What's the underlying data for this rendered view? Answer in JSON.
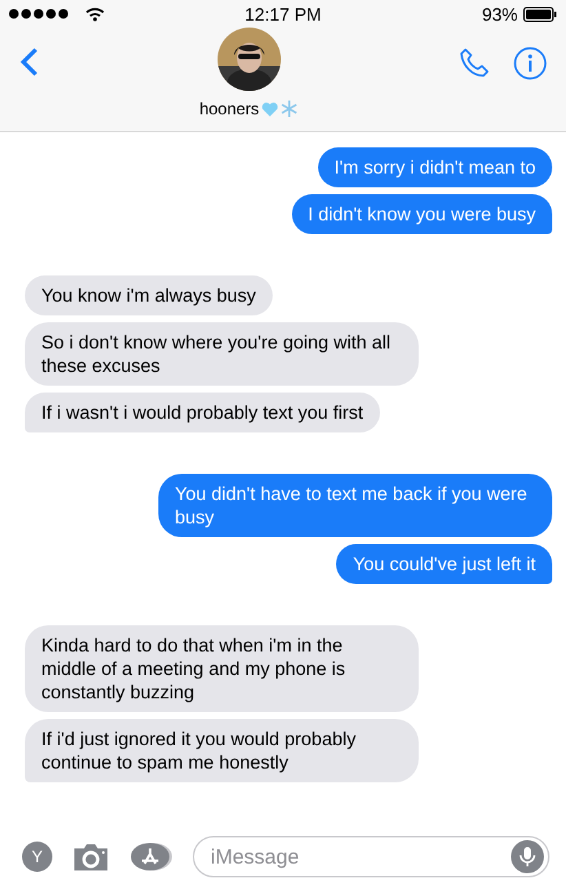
{
  "status_bar": {
    "time": "12:17 PM",
    "battery": "93%"
  },
  "contact": {
    "name": "hooners"
  },
  "groups": [
    {
      "kind": "sent",
      "messages": [
        "I'm sorry i didn't mean to",
        "I didn't know you were busy"
      ]
    },
    {
      "kind": "received",
      "messages": [
        "You know i'm always busy",
        "So i don't know where you're going with all these excuses",
        "If i wasn't i would probably text you first"
      ]
    },
    {
      "kind": "sent",
      "messages": [
        "You didn't have to text me back if you were busy",
        "You could've just left it"
      ]
    },
    {
      "kind": "received",
      "messages": [
        "Kinda hard to do that when i'm in the middle of a meeting and my phone is constantly buzzing",
        "If i'd just ignored it you would probably continue to spam me honestly"
      ]
    }
  ],
  "input_bar": {
    "app_letter": "Y",
    "placeholder": "iMessage"
  }
}
